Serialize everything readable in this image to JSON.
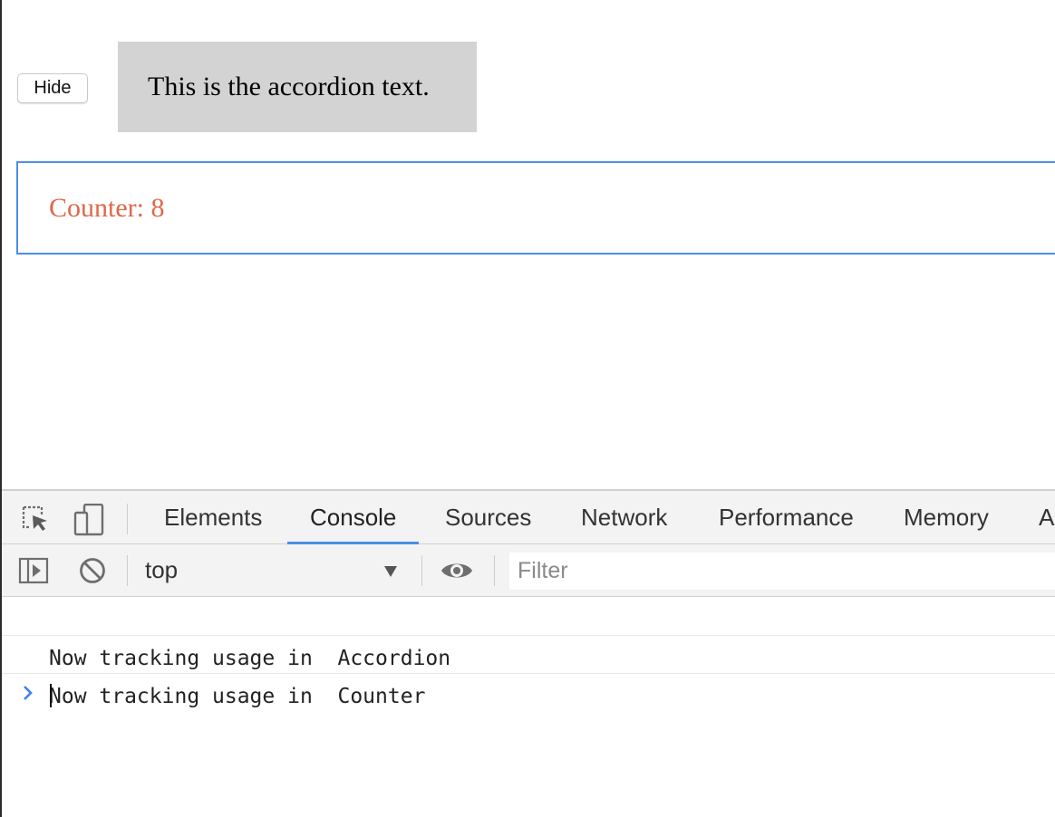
{
  "page": {
    "hide_button_label": "Hide",
    "accordion_text": "This is the accordion text.",
    "counter_text": "Counter: 8"
  },
  "devtools": {
    "tabs": [
      {
        "label": "Elements",
        "active": false
      },
      {
        "label": "Console",
        "active": true
      },
      {
        "label": "Sources",
        "active": false
      },
      {
        "label": "Network",
        "active": false
      },
      {
        "label": "Performance",
        "active": false
      },
      {
        "label": "Memory",
        "active": false
      },
      {
        "label": "Application",
        "active": false
      }
    ],
    "icons": {
      "inspect": "inspect-element-icon",
      "device": "device-toolbar-icon",
      "sidebar": "show-sidebar-icon",
      "clear": "clear-console-icon",
      "eye": "live-expression-eye-icon",
      "dropdown": "dropdown-arrow-icon",
      "prompt": "console-prompt-chevron-icon"
    },
    "context_selector": "top",
    "filter_placeholder": "Filter",
    "console_logs": [
      "Now tracking usage in  Accordion",
      "Now tracking usage in  Counter"
    ]
  },
  "colors": {
    "counter_text": "#e0674a",
    "counter_border": "#4a90e2",
    "accordion_bg": "#d3d3d3",
    "active_tab_underline": "#4a8fe7",
    "prompt_chevron": "#3b82f6"
  }
}
